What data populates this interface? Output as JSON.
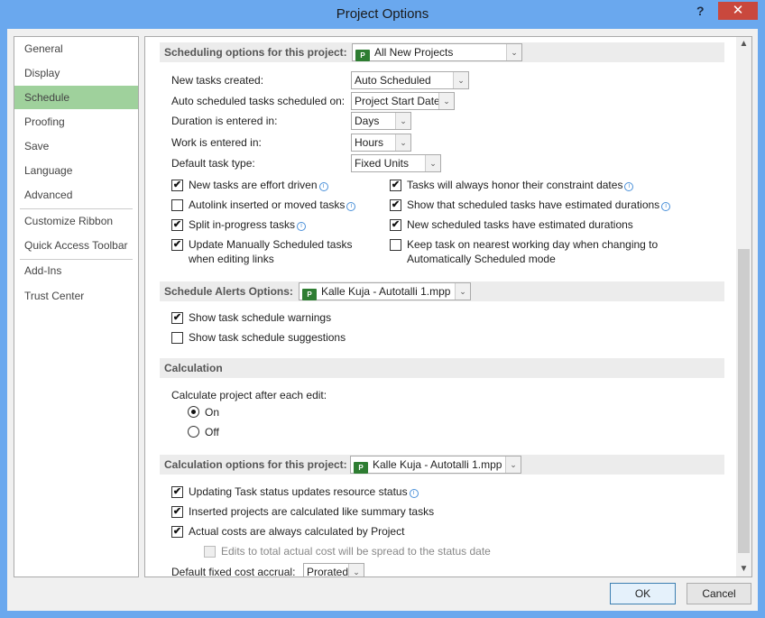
{
  "window": {
    "title": "Project Options",
    "help": "?",
    "close": "✕"
  },
  "sidebar": {
    "items": [
      {
        "label": "General"
      },
      {
        "label": "Display"
      },
      {
        "label": "Schedule",
        "selected": true
      },
      {
        "label": "Proofing"
      },
      {
        "label": "Save"
      },
      {
        "label": "Language"
      },
      {
        "label": "Advanced"
      },
      {
        "label": "Customize Ribbon"
      },
      {
        "label": "Quick Access Toolbar"
      },
      {
        "label": "Add-Ins"
      },
      {
        "label": "Trust Center"
      }
    ]
  },
  "scheduling": {
    "header": "Scheduling options for this project:",
    "project": "All New Projects",
    "fields": [
      {
        "label": "New tasks created:",
        "value": "Auto Scheduled"
      },
      {
        "label": "Auto scheduled tasks scheduled on:",
        "value": "Project Start Date"
      },
      {
        "label": "Duration is entered in:",
        "value": "Days"
      },
      {
        "label": "Work is entered in:",
        "value": "Hours"
      },
      {
        "label": "Default task type:",
        "value": "Fixed Units"
      }
    ],
    "left_checks": [
      {
        "label": "New tasks are effort driven",
        "checked": true,
        "info": true
      },
      {
        "label": "Autolink inserted or moved tasks",
        "checked": false,
        "info": true
      },
      {
        "label": "Split in-progress tasks",
        "checked": true,
        "info": true
      },
      {
        "label": "Update Manually Scheduled tasks",
        "label2": "when editing links",
        "checked": true
      }
    ],
    "right_checks": [
      {
        "label": "Tasks will always honor their constraint dates",
        "checked": true,
        "info": true
      },
      {
        "label": "Show that scheduled tasks have estimated durations",
        "checked": true,
        "info": true
      },
      {
        "label": "New scheduled tasks have estimated durations",
        "checked": true
      },
      {
        "label": "Keep task on nearest working day when changing to",
        "label2": "Automatically Scheduled mode",
        "checked": false
      }
    ]
  },
  "alerts": {
    "header": "Schedule Alerts Options:",
    "project": "Kalle Kuja - Autotalli 1.mpp",
    "checks": [
      {
        "label": "Show task schedule warnings",
        "checked": true
      },
      {
        "label": "Show task schedule suggestions",
        "checked": false
      }
    ]
  },
  "calculation": {
    "header": "Calculation",
    "label": "Calculate project after each edit:",
    "options": [
      {
        "label": "On",
        "selected": true
      },
      {
        "label": "Off",
        "selected": false
      }
    ]
  },
  "calc_options": {
    "header": "Calculation options for this project:",
    "project": "Kalle Kuja - Autotalli 1.mpp",
    "checks": [
      {
        "label": "Updating Task status updates resource status",
        "checked": true,
        "info": true
      },
      {
        "label": "Inserted projects are calculated like summary tasks",
        "checked": true
      },
      {
        "label": "Actual costs are always calculated by Project",
        "checked": true
      },
      {
        "label": "Edits to total actual cost will be spread to the status date",
        "checked": false,
        "disabled": true
      }
    ],
    "accrual_label": "Default fixed cost accrual:",
    "accrual_value": "Prorated"
  },
  "buttons": {
    "ok": "OK",
    "cancel": "Cancel"
  },
  "icons": {
    "checkmark": "✔",
    "dropdown": "⌄",
    "info": "i"
  }
}
